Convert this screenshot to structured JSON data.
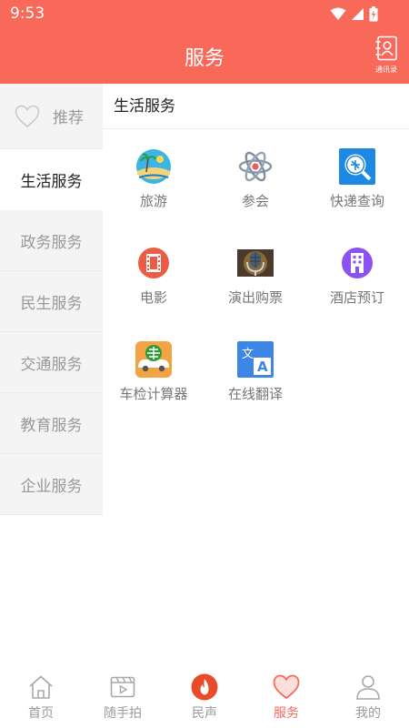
{
  "status_bar": {
    "time": "9:53"
  },
  "header": {
    "title": "服务",
    "contacts_label": "通讯录"
  },
  "sidebar": {
    "items": [
      {
        "label": "推荐"
      },
      {
        "label": "生活服务"
      },
      {
        "label": "政务服务"
      },
      {
        "label": "民生服务"
      },
      {
        "label": "交通服务"
      },
      {
        "label": "教育服务"
      },
      {
        "label": "企业服务"
      }
    ]
  },
  "content": {
    "section_title": "生活服务",
    "services": [
      {
        "label": "旅游",
        "icon": "beach-island-icon"
      },
      {
        "label": "参会",
        "icon": "atom-icon"
      },
      {
        "label": "快递查询",
        "icon": "express-search-icon"
      },
      {
        "label": "电影",
        "icon": "film-icon"
      },
      {
        "label": "演出购票",
        "icon": "microphone-icon"
      },
      {
        "label": "酒店预订",
        "icon": "hotel-building-icon"
      },
      {
        "label": "车检计算器",
        "icon": "car-calculator-icon"
      },
      {
        "label": "在线翻译",
        "icon": "translate-icon"
      }
    ]
  },
  "tabbar": {
    "items": [
      {
        "label": "首页",
        "icon": "home-icon"
      },
      {
        "label": "随手拍",
        "icon": "video-icon"
      },
      {
        "label": "民声",
        "icon": "flame-icon"
      },
      {
        "label": "服务",
        "icon": "heart-icon"
      },
      {
        "label": "我的",
        "icon": "person-icon"
      }
    ]
  },
  "colors": {
    "brand": "#f8695a",
    "sidebar_bg": "#f4f4f4",
    "muted_text": "#999999"
  }
}
